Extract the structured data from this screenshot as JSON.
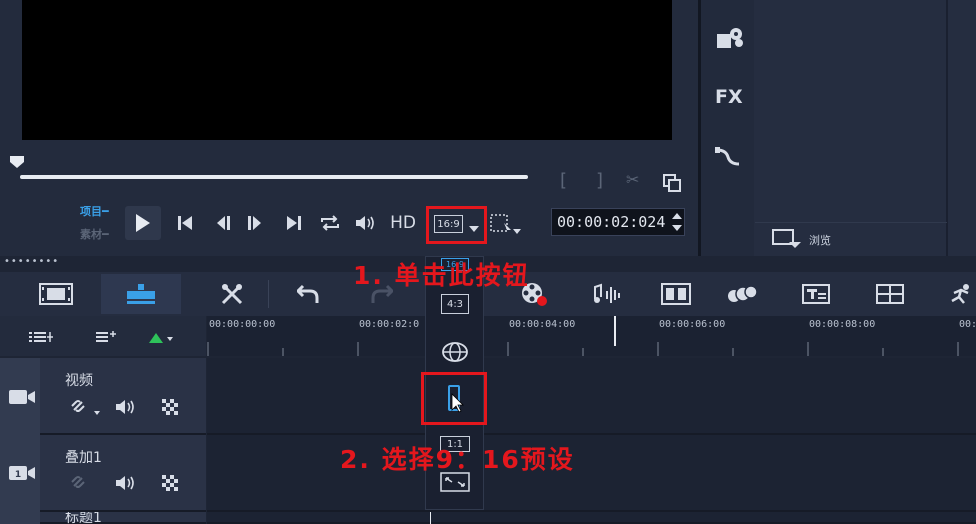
{
  "player": {
    "project_label": "项目",
    "clip_label": "素材",
    "hd_label": "HD",
    "timecode": "00:00:02:024",
    "aspect_ratio_label": "16:9"
  },
  "library": {
    "fx_label": "FX",
    "browse_label": "浏览"
  },
  "timeline": {
    "ruler": [
      "00:00:00:00",
      "00:00:02:0",
      "00:00:04:00",
      "00:00:06:00",
      "00:00:08:00",
      "00:"
    ]
  },
  "tracks": [
    {
      "name": "视频"
    },
    {
      "name": "叠加1"
    },
    {
      "name": "标题1"
    }
  ],
  "aspect_menu": {
    "options": [
      "16:9",
      "4:3",
      "",
      "",
      "1:1",
      ""
    ]
  },
  "annotations": {
    "step1": "1. 单击此按钮",
    "step2": "2. 选择9：16预设"
  },
  "colors": {
    "accent_blue": "#3aa0e8",
    "annotation_red": "#e4171d",
    "green_arrow": "#2ec25a"
  }
}
